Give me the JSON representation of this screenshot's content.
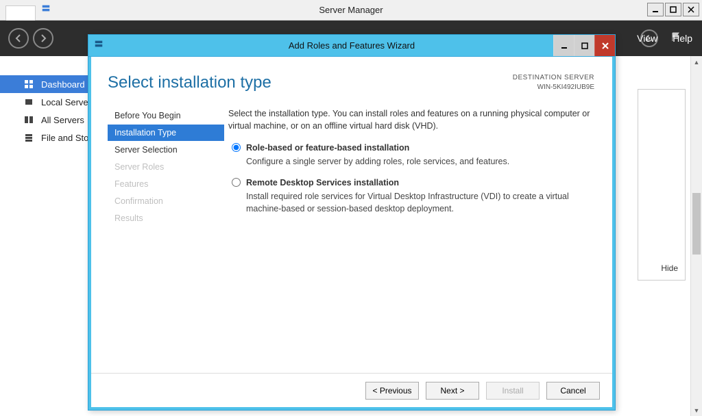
{
  "outer": {
    "title": "Server Manager",
    "menu": {
      "view": "View",
      "help": "Help"
    }
  },
  "sidebar": {
    "items": [
      {
        "label": "Dashboard",
        "icon": "dashboard-icon",
        "active": true
      },
      {
        "label": "Local Server",
        "icon": "server-icon"
      },
      {
        "label": "All Servers",
        "icon": "servers-icon"
      },
      {
        "label": "File and Storage Services",
        "icon": "storage-icon"
      }
    ],
    "hide": "Hide"
  },
  "wizard": {
    "title": "Add Roles and Features Wizard",
    "heading": "Select installation type",
    "destination": {
      "label": "DESTINATION SERVER",
      "value": "WIN-5KI492IUB9E"
    },
    "description": "Select the installation type. You can install roles and features on a running physical computer or virtual machine, or on an offline virtual hard disk (VHD).",
    "steps": [
      {
        "label": "Before You Begin"
      },
      {
        "label": "Installation Type",
        "active": true
      },
      {
        "label": "Server Selection"
      },
      {
        "label": "Server Roles",
        "disabled": true
      },
      {
        "label": "Features",
        "disabled": true
      },
      {
        "label": "Confirmation",
        "disabled": true
      },
      {
        "label": "Results",
        "disabled": true
      }
    ],
    "options": [
      {
        "label": "Role-based or feature-based installation",
        "desc": "Configure a single server by adding roles, role services, and features.",
        "selected": true
      },
      {
        "label": "Remote Desktop Services installation",
        "desc": "Install required role services for Virtual Desktop Infrastructure (VDI) to create a virtual machine-based or session-based desktop deployment.",
        "selected": false
      }
    ],
    "buttons": {
      "previous": "< Previous",
      "next": "Next >",
      "install": "Install",
      "cancel": "Cancel"
    }
  }
}
